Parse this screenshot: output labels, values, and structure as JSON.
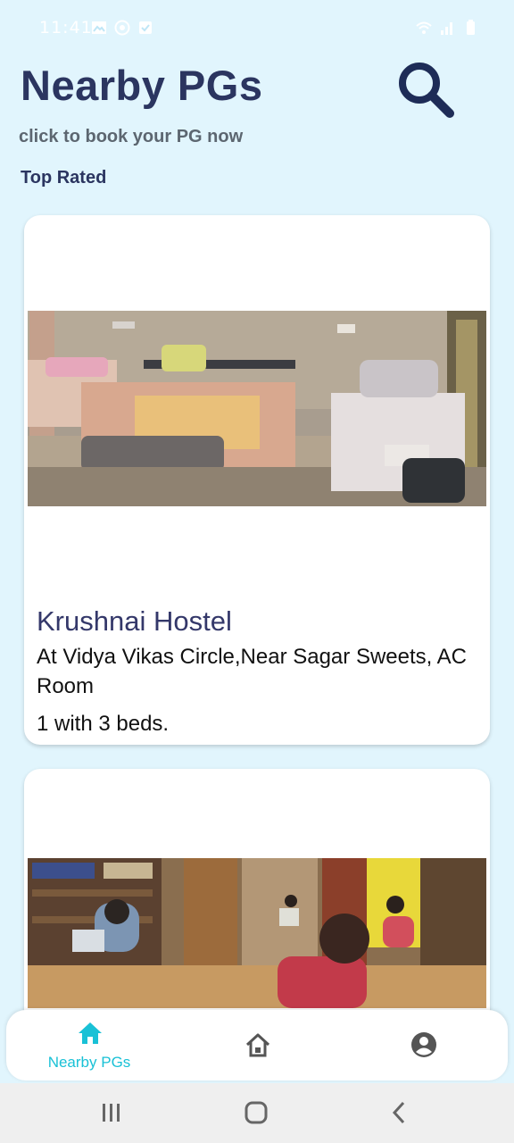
{
  "status_bar": {
    "time": "11:41",
    "icons_left": [
      "gallery-icon",
      "whatsapp-icon",
      "check-box-icon"
    ],
    "icons_right": [
      "wifi-icon",
      "signal-icon",
      "battery-icon"
    ]
  },
  "header": {
    "title": "Nearby PGs",
    "subtitle": "click to book your PG now",
    "search_icon": "search-icon"
  },
  "section": {
    "label": "Top Rated"
  },
  "listings": [
    {
      "name": "Krushnai Hostel",
      "address": "At Vidya Vikas Circle,Near Sagar Sweets, AC Room",
      "rooms": "1 with 3 beds.",
      "photo": "hostel-bedroom-photo"
    },
    {
      "name": "",
      "address": "",
      "rooms": "",
      "photo": "hostel-study-room-photo"
    }
  ],
  "bottom_nav": {
    "items": [
      {
        "label": "Nearby PGs",
        "icon": "home-icon",
        "active": true
      },
      {
        "label": "",
        "icon": "house-pg-icon",
        "active": false
      },
      {
        "label": "",
        "icon": "account-icon",
        "active": false
      }
    ],
    "active_color": "#19c1d6",
    "inactive_color": "#555555"
  },
  "system_nav": [
    "recent-apps-icon",
    "home-circle-icon",
    "back-icon"
  ],
  "colors": {
    "background": "#e1f5fd",
    "title": "#2b3560",
    "subtitle": "#5c6670",
    "card_title": "#34386a"
  }
}
